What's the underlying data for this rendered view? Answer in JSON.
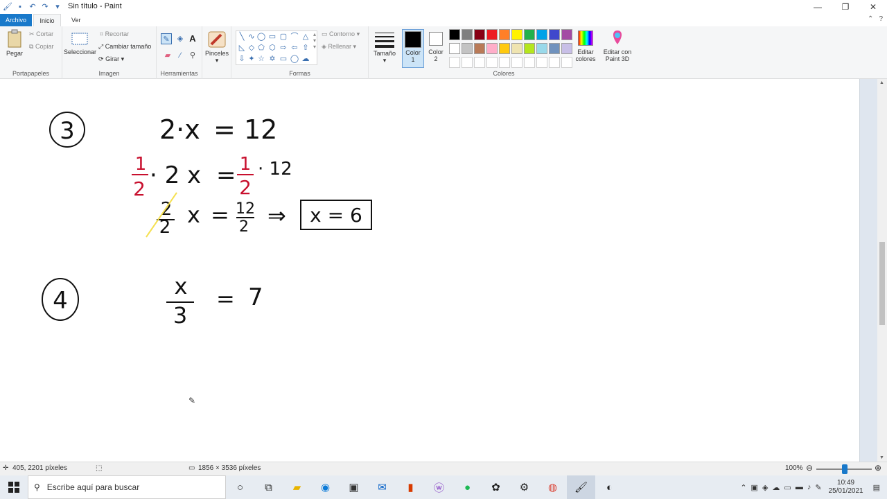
{
  "window": {
    "title": "Sin título - Paint",
    "minimize": "—",
    "restore": "❐",
    "close": "✕"
  },
  "tabs": {
    "file": "Archivo",
    "home": "Inicio",
    "view": "Ver"
  },
  "ribbon": {
    "clipboard": {
      "paste": "Pegar",
      "cut": "Cortar",
      "copy": "Copiar",
      "label": "Portapapeles"
    },
    "image": {
      "select": "Seleccionar",
      "crop": "Recortar",
      "resize": "Cambiar tamaño",
      "rotate": "Girar",
      "label": "Imagen"
    },
    "tools": {
      "label": "Herramientas"
    },
    "brushes": "Pinceles",
    "shapes": {
      "outline": "Contorno",
      "fill": "Rellenar",
      "label": "Formas"
    },
    "size": "Tamaño",
    "color1": {
      "l1": "Color",
      "l2": "1"
    },
    "color2": {
      "l1": "Color",
      "l2": "2"
    },
    "edit_colors": {
      "l1": "Editar",
      "l2": "colores"
    },
    "paint3d": {
      "l1": "Editar con",
      "l2": "Paint 3D"
    },
    "colors_label": "Colores",
    "palette_row1": [
      "#000000",
      "#7f7f7f",
      "#880015",
      "#ed1c24",
      "#ff7f27",
      "#fff200",
      "#22b14c",
      "#00a2e8",
      "#3f48cc",
      "#a349a4"
    ],
    "palette_row2": [
      "#ffffff",
      "#c3c3c3",
      "#b97a57",
      "#ffaec9",
      "#ffc90e",
      "#efe4b0",
      "#b5e61d",
      "#99d9ea",
      "#7092be",
      "#c8bfe7"
    ]
  },
  "drawing": {
    "n3": "3",
    "eq1_lhs": "2·x",
    "eq1_eq": "=",
    "eq1_rhs": "12",
    "frac_num": "1",
    "frac_den": "2",
    "eq2_mid": "· 2 x",
    "eq2_eq": "=",
    "eq2_rhs": "· 12",
    "eq3_num": "2",
    "eq3_den": "2",
    "eq3_x": "x",
    "eq3_eq": "=",
    "eq3_rnum": "12",
    "eq3_rden": "2",
    "arrow": "⇒",
    "answer": "x = 6",
    "n4": "4",
    "eq4_num": "x",
    "eq4_den": "3",
    "eq4_eq": "=",
    "eq4_rhs": "7"
  },
  "status": {
    "cursor_pos": "405, 2201 píxeles",
    "image_size": "1856 × 3536 píxeles",
    "zoom": "100%"
  },
  "taskbar": {
    "search_placeholder": "Escribe aquí para buscar",
    "time": "10:49",
    "date": "25/01/2021"
  }
}
